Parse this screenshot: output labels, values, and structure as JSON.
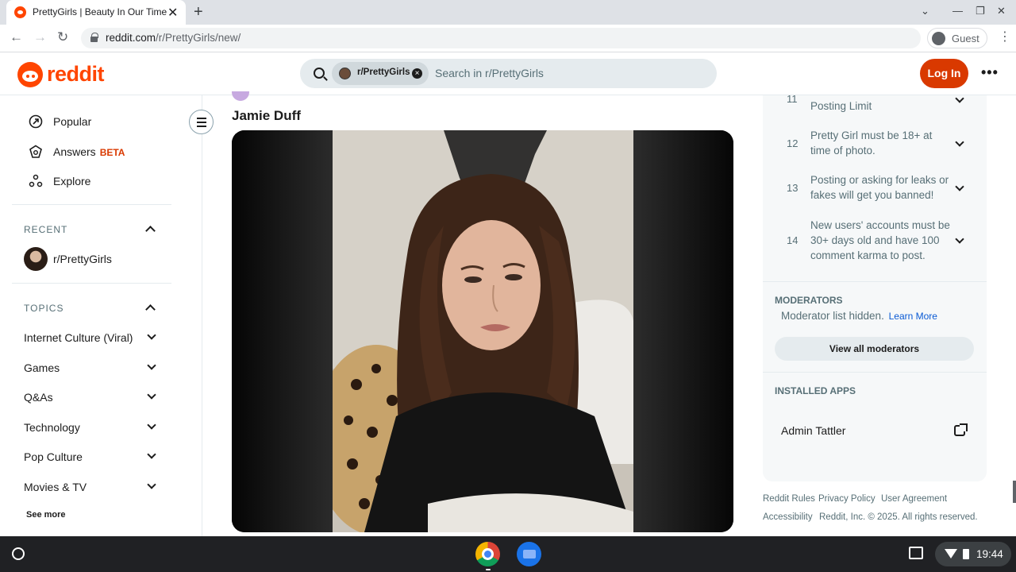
{
  "browser": {
    "tab_title": "PrettyGirls | Beauty In Our Time",
    "tab_close": "✕",
    "new_tab": "+",
    "url_host": "reddit.com",
    "url_path": "/r/PrettyGirls/new/",
    "guest_label": "Guest",
    "nav": {
      "back": "←",
      "forward": "→",
      "reload": "↻"
    },
    "menu": "⋮",
    "window_controls": {
      "tab_search": "⌄",
      "minimize": "—",
      "restore": "❐",
      "close": "✕"
    }
  },
  "header": {
    "logo_text": "reddit",
    "search_chip": "r/PrettyGirls",
    "search_chip_close": "×",
    "search_placeholder": "Search in r/PrettyGirls",
    "login_label": "Log In",
    "more_label": "•••"
  },
  "left_nav": {
    "items": [
      {
        "label": "Popular",
        "icon": "popular-icon"
      },
      {
        "label": "Answers",
        "badge": "BETA",
        "icon": "answers-icon"
      },
      {
        "label": "Explore",
        "icon": "explore-icon"
      }
    ],
    "recent_heading": "RECENT",
    "recent": [
      {
        "label": "r/PrettyGirls"
      }
    ],
    "topics_heading": "TOPICS",
    "topics": [
      "Internet Culture (Viral)",
      "Games",
      "Q&As",
      "Technology",
      "Pop Culture",
      "Movies & TV"
    ],
    "see_more": "See more"
  },
  "post": {
    "title": "Jamie Duff",
    "image_description_icon": "photo"
  },
  "right_sidebar": {
    "rules": [
      {
        "num": "11",
        "text": "Posting Limit"
      },
      {
        "num": "12",
        "text": "Pretty Girl must be 18+ at time of photo."
      },
      {
        "num": "13",
        "text": "Posting or asking for leaks or fakes will get you banned!"
      },
      {
        "num": "14",
        "text": "New users' accounts must be 30+ days old and have 100 comment karma to post."
      }
    ],
    "moderators_heading": "MODERATORS",
    "moderators_text": "Moderator list hidden.",
    "moderators_link": "Learn More",
    "moderators_button": "View all moderators",
    "apps_heading": "INSTALLED APPS",
    "apps": [
      {
        "name": "Admin Tattler"
      }
    ]
  },
  "footer": {
    "links": [
      "Reddit Rules",
      "Privacy Policy",
      "User Agreement",
      "Accessibility"
    ],
    "copyright": "Reddit, Inc. © 2025. All rights reserved."
  },
  "shelf": {
    "time": "19:44"
  },
  "colors": {
    "brand": "#ff4500",
    "login": "#d93900",
    "link": "#0a5ad4"
  }
}
